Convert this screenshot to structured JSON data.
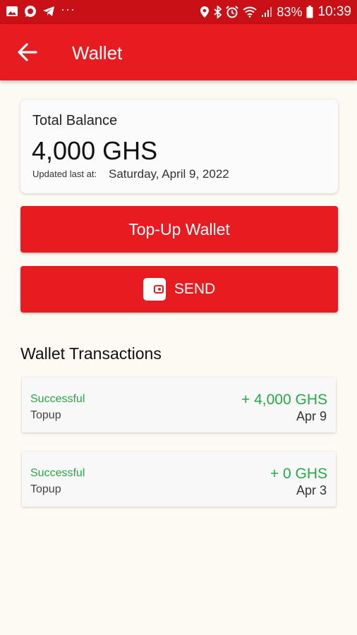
{
  "status_bar": {
    "left_icons": [
      "image-icon",
      "whatsapp-icon",
      "telegram-icon"
    ],
    "more": "···",
    "right_icons": [
      "location-icon",
      "bluetooth-icon",
      "alarm-icon",
      "wifi-icon",
      "signal-icon",
      "battery-icon"
    ],
    "battery": "83%",
    "time": "10:39"
  },
  "app_bar": {
    "title": "Wallet",
    "back_icon": "arrow-left-icon"
  },
  "balance": {
    "label": "Total Balance",
    "amount": "4,000 GHS",
    "updated_label": "Updated last at:",
    "updated_date": "Saturday, April 9, 2022"
  },
  "actions": {
    "topup_label": "Top-Up Wallet",
    "send_label": "SEND",
    "send_icon": "wallet-icon"
  },
  "transactions": {
    "title": "Wallet Transactions",
    "items": [
      {
        "status": "Successful",
        "type": "Topup",
        "amount": "+ 4,000 GHS",
        "date": "Apr 9"
      },
      {
        "status": "Successful",
        "type": "Topup",
        "amount": "+ 0 GHS",
        "date": "Apr 3"
      }
    ]
  },
  "colors": {
    "status_bar": "#c91016",
    "primary": "#e81c20",
    "success": "#27a844",
    "background": "#fdf9f3"
  }
}
